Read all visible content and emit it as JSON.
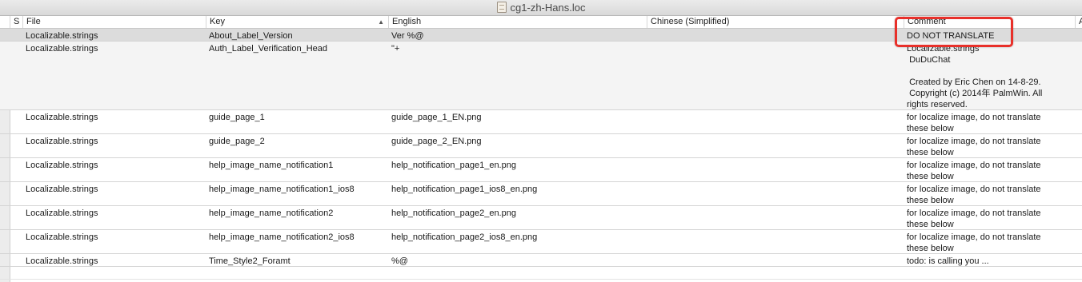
{
  "window": {
    "title": "cg1-zh-Hans.loc",
    "icon": "document-icon"
  },
  "columns": {
    "status": "S",
    "file": "File",
    "key": "Key",
    "english": "English",
    "chinese": "Chinese (Simplified)",
    "comment": "Comment",
    "extra": "A"
  },
  "rows": [
    {
      "file": "Localizable.strings",
      "key": "About_Label_Version",
      "english": "Ver %@",
      "chinese": "",
      "comment": "DO NOT TRANSLATE",
      "selected": true
    },
    {
      "file": "Localizable.strings",
      "key": "Auth_Label_Verification_Head",
      "english": "\"+",
      "chinese": "",
      "comment": "Localizable.strings\n DuDuChat\n\n Created by Eric Chen on 14-8-29.\n Copyright (c) 2014年 PalmWin. All\nrights reserved."
    },
    {
      "file": "Localizable.strings",
      "key": "guide_page_1",
      "english": "guide_page_1_EN.png",
      "chinese": "",
      "comment": "for localize image, do not translate\nthese below"
    },
    {
      "file": "Localizable.strings",
      "key": "guide_page_2",
      "english": "guide_page_2_EN.png",
      "chinese": "",
      "comment": "for localize image, do not translate\nthese below"
    },
    {
      "file": "Localizable.strings",
      "key": "help_image_name_notification1",
      "english": "help_notification_page1_en.png",
      "chinese": "",
      "comment": "for localize image, do not translate\nthese below"
    },
    {
      "file": "Localizable.strings",
      "key": "help_image_name_notification1_ios8",
      "english": "help_notification_page1_ios8_en.png",
      "chinese": "",
      "comment": "for localize image, do not translate\nthese below"
    },
    {
      "file": "Localizable.strings",
      "key": "help_image_name_notification2",
      "english": "help_notification_page2_en.png",
      "chinese": "",
      "comment": "for localize image, do not translate\nthese below"
    },
    {
      "file": "Localizable.strings",
      "key": "help_image_name_notification2_ios8",
      "english": "help_notification_page2_ios8_en.png",
      "chinese": "",
      "comment": "for localize image, do not translate\nthese below"
    },
    {
      "file": "Localizable.strings",
      "key": "Time_Style2_Foramt",
      "english": "%@",
      "chinese": "",
      "comment": "todo: is calling you ..."
    }
  ],
  "colors": {
    "highlight": "#e8302a",
    "selected_row": "#dcdcdc"
  }
}
